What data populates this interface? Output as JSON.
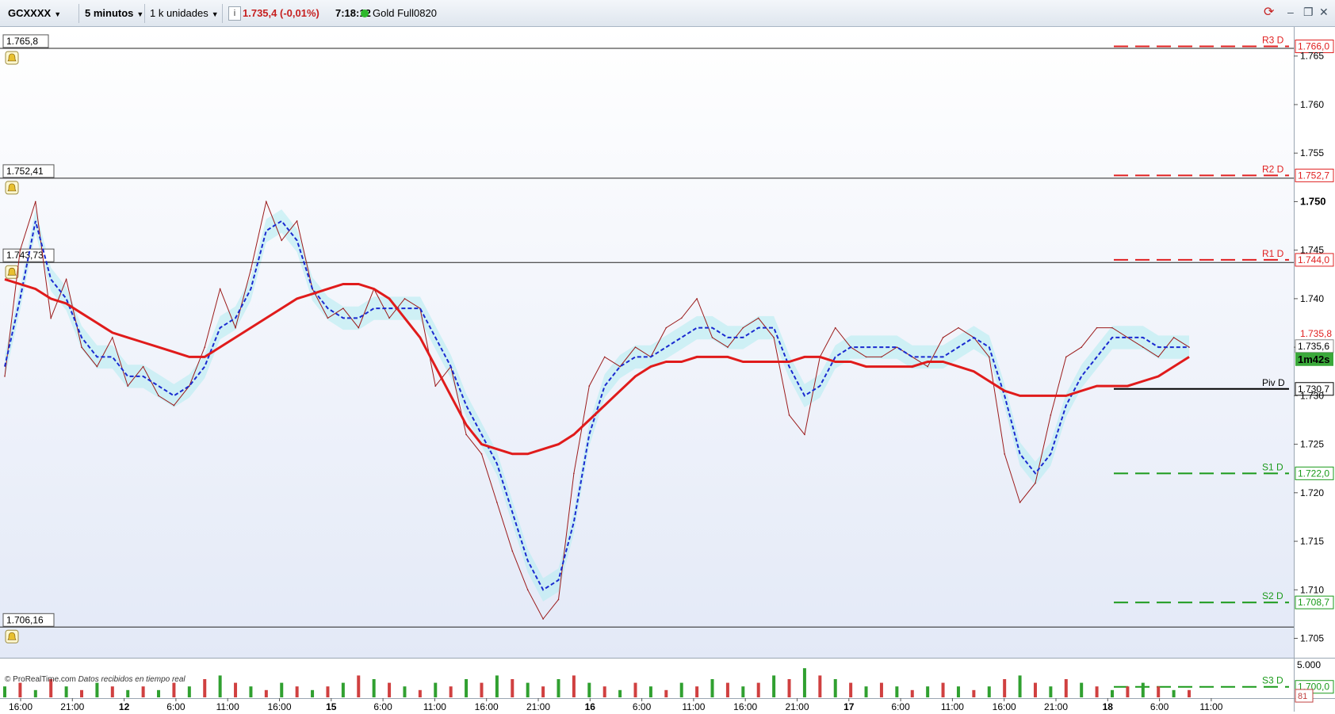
{
  "toolbar": {
    "symbol": "GCXXXX",
    "timeframe": "5 minutos",
    "units": "1 k unidades",
    "info_icon": "info-icon",
    "quote": "1.735,4 (-0,01%)",
    "time": "7:18:12",
    "instrument": "Gold Full0820",
    "status_color": "#2db82d"
  },
  "levels_left": [
    {
      "label": "1.765,8",
      "price": 1765.8
    },
    {
      "label": "1.752,41",
      "price": 1752.41
    },
    {
      "label": "1.743,73",
      "price": 1743.73
    },
    {
      "label": "1.706,16",
      "price": 1706.16
    }
  ],
  "pivots": [
    {
      "name": "R3 D",
      "value_label": "1.766,0",
      "price": 1766.0,
      "color": "#e02020"
    },
    {
      "name": "R2 D",
      "value_label": "1.752,7",
      "price": 1752.7,
      "color": "#e02020"
    },
    {
      "name": "R1 D",
      "value_label": "1.744,0",
      "price": 1744.0,
      "color": "#e02020"
    },
    {
      "name": "Piv D",
      "value_label": "1.730,7",
      "price": 1730.7,
      "color": "#000000"
    },
    {
      "name": "S1 D",
      "value_label": "1.722,0",
      "price": 1722.0,
      "color": "#1a9a1a"
    },
    {
      "name": "S2 D",
      "value_label": "1.708,7",
      "price": 1708.7,
      "color": "#1a9a1a"
    },
    {
      "name": "S3 D",
      "value_label": "1.700,0",
      "price": 1700.0,
      "color": "#1a9a1a"
    }
  ],
  "price_axis": {
    "ticks": [
      {
        "label": "1.765",
        "price": 1765
      },
      {
        "label": "1.760",
        "price": 1760
      },
      {
        "label": "1.755",
        "price": 1755
      },
      {
        "label": "1.750",
        "price": 1750,
        "bold": true
      },
      {
        "label": "1.745",
        "price": 1745
      },
      {
        "label": "1.740",
        "price": 1740
      },
      {
        "label": "1.735",
        "price": 1735
      },
      {
        "label": "1.730",
        "price": 1730
      },
      {
        "label": "1.725",
        "price": 1725
      },
      {
        "label": "1.720",
        "price": 1720
      },
      {
        "label": "1.715",
        "price": 1715
      },
      {
        "label": "1.710",
        "price": 1710
      },
      {
        "label": "1.705",
        "price": 1705
      }
    ],
    "current_price_label": "1.735,6",
    "countdown": "1m42s",
    "hidden_label": "1.735,8"
  },
  "time_axis": [
    {
      "label": "16:00",
      "bold": false
    },
    {
      "label": "21:00",
      "bold": false
    },
    {
      "label": "12",
      "bold": true
    },
    {
      "label": "6:00",
      "bold": false
    },
    {
      "label": "11:00",
      "bold": false
    },
    {
      "label": "16:00",
      "bold": false
    },
    {
      "label": "15",
      "bold": true
    },
    {
      "label": "6:00",
      "bold": false
    },
    {
      "label": "11:00",
      "bold": false
    },
    {
      "label": "16:00",
      "bold": false
    },
    {
      "label": "21:00",
      "bold": false
    },
    {
      "label": "16",
      "bold": true
    },
    {
      "label": "6:00",
      "bold": false
    },
    {
      "label": "11:00",
      "bold": false
    },
    {
      "label": "16:00",
      "bold": false
    },
    {
      "label": "21:00",
      "bold": false
    },
    {
      "label": "17",
      "bold": true
    },
    {
      "label": "6:00",
      "bold": false
    },
    {
      "label": "11:00",
      "bold": false
    },
    {
      "label": "16:00",
      "bold": false
    },
    {
      "label": "21:00",
      "bold": false
    },
    {
      "label": "18",
      "bold": true
    },
    {
      "label": "6:00",
      "bold": false
    },
    {
      "label": "11:00",
      "bold": false
    }
  ],
  "volume_axis": {
    "tick": "5.000",
    "current": "81"
  },
  "footer": {
    "source": "© ProRealTime.com",
    "note": "Datos recibidos en tiempo real"
  },
  "chart_data": {
    "type": "line",
    "price_range": [
      1703,
      1768
    ],
    "series": [
      {
        "name": "",
        "color": "#9b1b1b",
        "values": [
          1732,
          1745,
          1750,
          1738,
          1742,
          1735,
          1733,
          1736,
          1731,
          1733,
          1730,
          1729,
          1731,
          1735,
          1741,
          1737,
          1743,
          1750,
          1746,
          1748,
          1741,
          1738,
          1739,
          1737,
          1741,
          1738,
          1740,
          1739,
          1731,
          1733,
          1726,
          1724,
          1719,
          1714,
          1710,
          1707,
          1709,
          1722,
          1731,
          1734,
          1733,
          1735,
          1734,
          1737,
          1738,
          1740,
          1736,
          1735,
          1737,
          1738,
          1736,
          1728,
          1726,
          1734,
          1737,
          1735,
          1734,
          1734,
          1735,
          1734,
          1733,
          1736,
          1737,
          1736,
          1734,
          1724,
          1719,
          1721,
          1728,
          1734,
          1735,
          1737,
          1737,
          1736,
          1735,
          1734,
          1736,
          1735
        ]
      },
      {
        "name": "",
        "color": "#1a2ad0",
        "values": [
          1733,
          1740,
          1748,
          1742,
          1740,
          1736,
          1734,
          1734,
          1732,
          1732,
          1731,
          1730,
          1731,
          1733,
          1737,
          1738,
          1741,
          1747,
          1748,
          1746,
          1741,
          1739,
          1738,
          1738,
          1739,
          1739,
          1739,
          1739,
          1736,
          1733,
          1729,
          1726,
          1723,
          1718,
          1713,
          1710,
          1711,
          1717,
          1726,
          1731,
          1733,
          1734,
          1734,
          1735,
          1736,
          1737,
          1737,
          1736,
          1736,
          1737,
          1737,
          1733,
          1730,
          1731,
          1734,
          1735,
          1735,
          1735,
          1735,
          1734,
          1734,
          1734,
          1735,
          1736,
          1735,
          1730,
          1724,
          1722,
          1724,
          1729,
          1732,
          1734,
          1736,
          1736,
          1736,
          1735,
          1735,
          1735
        ]
      },
      {
        "name": "",
        "color": "#e01b1b",
        "values": [
          1742,
          1741.5,
          1741,
          1740,
          1739.5,
          1738.5,
          1737.5,
          1736.5,
          1736,
          1735.5,
          1735,
          1734.5,
          1734,
          1734,
          1735,
          1736,
          1737,
          1738,
          1739,
          1740,
          1740.5,
          1741,
          1741.5,
          1741.5,
          1741,
          1740,
          1738,
          1736,
          1733,
          1730,
          1727,
          1725,
          1724.5,
          1724,
          1724,
          1724.5,
          1725,
          1726,
          1727.5,
          1729,
          1730.5,
          1732,
          1733,
          1733.5,
          1733.5,
          1734,
          1734,
          1734,
          1733.5,
          1733.5,
          1733.5,
          1733.5,
          1734,
          1734,
          1733.5,
          1733.5,
          1733,
          1733,
          1733,
          1733,
          1733.5,
          1733.5,
          1733,
          1732.5,
          1731.5,
          1730.5,
          1730,
          1730,
          1730,
          1730,
          1730.5,
          1731,
          1731,
          1731,
          1731.5,
          1732,
          1733,
          1734
        ]
      }
    ],
    "volume": [
      3,
      4,
      2,
      5,
      3,
      2,
      4,
      3,
      2,
      3,
      2,
      4,
      3,
      5,
      6,
      4,
      3,
      2,
      4,
      3,
      2,
      3,
      4,
      6,
      5,
      4,
      3,
      2,
      4,
      3,
      5,
      4,
      6,
      5,
      4,
      3,
      5,
      6,
      4,
      3,
      2,
      4,
      3,
      2,
      4,
      3,
      5,
      4,
      3,
      4,
      6,
      5,
      8,
      6,
      5,
      4,
      3,
      4,
      3,
      2,
      3,
      4,
      3,
      2,
      3,
      5,
      6,
      4,
      3,
      5,
      4,
      3,
      2,
      3,
      4,
      3,
      2,
      2
    ]
  }
}
